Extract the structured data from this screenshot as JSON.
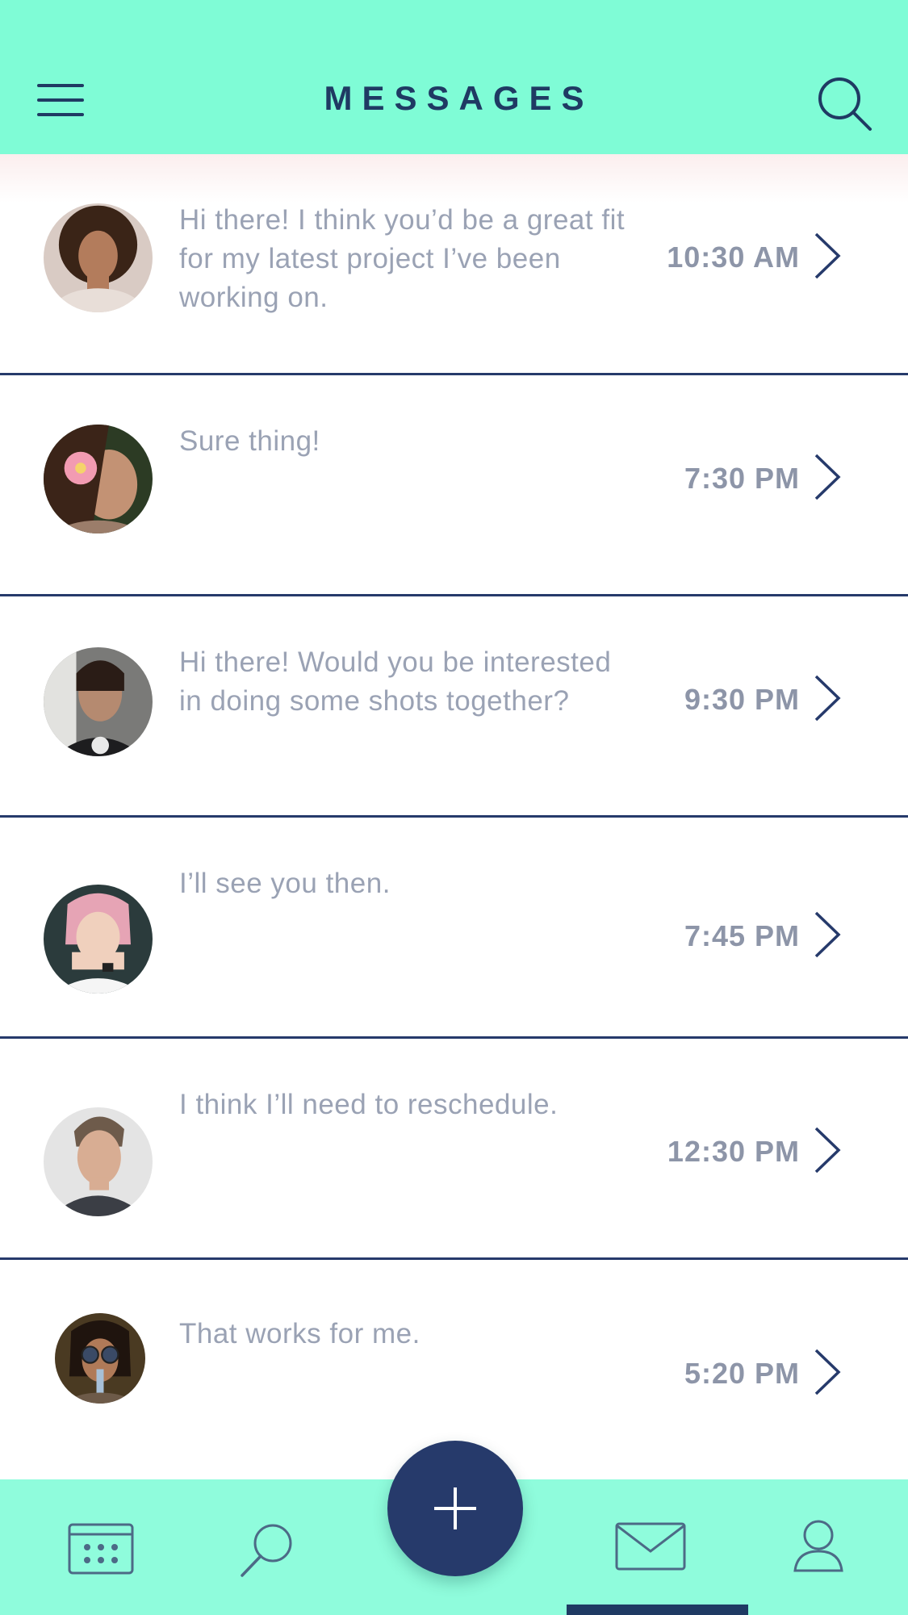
{
  "header": {
    "title": "MESSAGES"
  },
  "colors": {
    "accent": "#7ffcd6",
    "navy": "#1f3a63",
    "text_muted": "#9aa2b4"
  },
  "messages": [
    {
      "preview": "Hi there! I think you’d be a great fit for my latest project I’ve been working on.",
      "time": "10:30 AM"
    },
    {
      "preview": "Sure thing!",
      "time": "7:30 PM"
    },
    {
      "preview": "Hi there! Would you be interested in doing some shots together?",
      "time": "9:30 PM"
    },
    {
      "preview": "I’ll see you then.",
      "time": "7:45 PM"
    },
    {
      "preview": "I think I’ll need to reschedule.",
      "time": "12:30 PM"
    },
    {
      "preview": "That works for me.",
      "time": "5:20 PM"
    }
  ],
  "tabs": [
    {
      "icon": "calendar-icon"
    },
    {
      "icon": "search-icon"
    },
    {
      "icon": "plus-icon"
    },
    {
      "icon": "mail-icon"
    },
    {
      "icon": "profile-icon"
    }
  ],
  "active_tab": "mail"
}
